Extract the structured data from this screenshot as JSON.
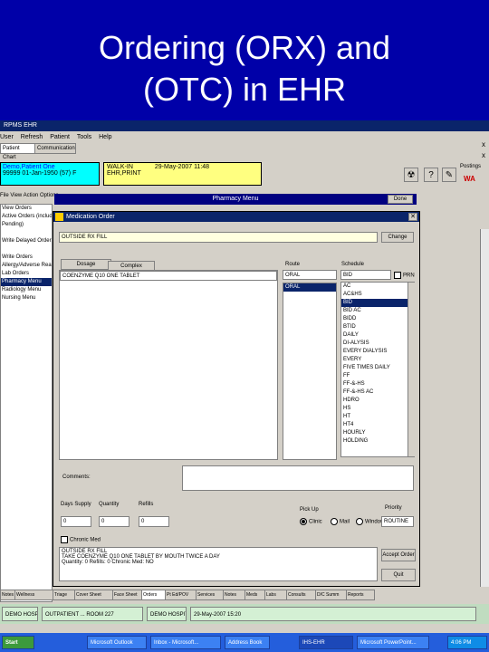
{
  "slide": {
    "title_line1": "Ordering (ORX) and",
    "title_line2": "(OTC) in EHR"
  },
  "app": {
    "window_title": "RPMS EHR",
    "menu": [
      "User",
      "Refresh",
      "Patient",
      "Tools",
      "Help"
    ],
    "top_tabs": [
      "Patient Chart",
      "Communication"
    ],
    "patient": {
      "name": "Demo,Patient One",
      "id_line": "99999",
      "dob_line": "01-Jan-1950 (57)",
      "sex": "F"
    },
    "visit": {
      "type": "WALK-IN",
      "date": "29-May-2007 11:48",
      "provider": "EHR,PRINT"
    },
    "right_labels": {
      "postings": "Postings",
      "wa": "WA"
    },
    "x_marks": [
      "x",
      "x",
      "x"
    ],
    "left_menu": [
      "File",
      "View",
      "Action",
      "Options"
    ],
    "left_panel": {
      "items": [
        "View Orders",
        "Active Orders (includes",
        "Pending)",
        "",
        "Write Delayed Orders",
        "",
        "Write Orders",
        "Allergy/Adverse React",
        "Lab Orders",
        "Pharmacy Menu",
        "Radiology Menu",
        "Nursing Menu"
      ],
      "selected_index": 9
    },
    "pharmacy_bar": "Pharmacy Menu",
    "done_label": "Done"
  },
  "dialog": {
    "title": "Medication Order",
    "order_text": "OUTSIDE RX FILL",
    "change_label": "Change",
    "tabs": [
      "Dosage",
      "Complex"
    ],
    "dosage_value": "COENZYME Q10 ONE TABLET",
    "route_label": "Route",
    "route_value": "ORAL",
    "route_options": [
      "ORAL"
    ],
    "schedule_label": "Schedule",
    "schedule_value": "BID",
    "prn_label": "PRN",
    "schedule_options": [
      "AC",
      "AC&HS",
      "BID",
      "BID AC",
      "BIDD",
      "BTID",
      "DAILY",
      "DI-ALYSIS",
      "EVERY DIALYSIS",
      "EVERY",
      "FIVE TIMES DAILY",
      "FF",
      "FF-&-HS",
      "FF-&-HS AC",
      "HDRO",
      "HS",
      "HT",
      "HT4",
      "HOURLY",
      "HOLDING"
    ],
    "schedule_selected": 2,
    "comments_label": "Comments:",
    "days_supply_label": "Days Supply",
    "days_supply_value": "0",
    "quantity_label": "Quantity",
    "quantity_value": "0",
    "refills_label": "Refills",
    "refills_value": "0",
    "pickup_label": "Pick Up",
    "pickup_options": [
      "Clinic",
      "Mail",
      "Window"
    ],
    "pickup_selected": 0,
    "priority_label": "Priority",
    "priority_value": "ROUTINE",
    "chronic_label": "Chronic Med",
    "summary_lines": [
      "OUTSIDE RX FILL",
      "TAKE COENZYME Q10 ONE TABLET BY MOUTH TWICE A DAY",
      "Quantity: 0 Refills: 0 Chronic Med: NO"
    ],
    "accept_label": "Accept Order",
    "quit_label": "Quit"
  },
  "bottom_tabs": [
    "Notes",
    "Wellness",
    "Triage",
    "Cover Sheet",
    "Face Sheet",
    "Orders",
    "Pt Ed/POV",
    "Services",
    "Notes",
    "Meds",
    "Labs",
    "Consults",
    "D/C Summ",
    "Reports"
  ],
  "bottom_tab_active": 5,
  "status_bar": [
    "DEMO HOSPITAL",
    "OUTPATIENT ... ROOM 227",
    "DEMO HOSPITAL",
    "29-May-2007 15:20"
  ],
  "taskbar": [
    "Start",
    "Microsoft Outlook",
    "Inbox - Microsoft...",
    "Address Book",
    "IHS-EHR",
    "Microsoft PowerPoint...",
    "4:06 PM"
  ]
}
